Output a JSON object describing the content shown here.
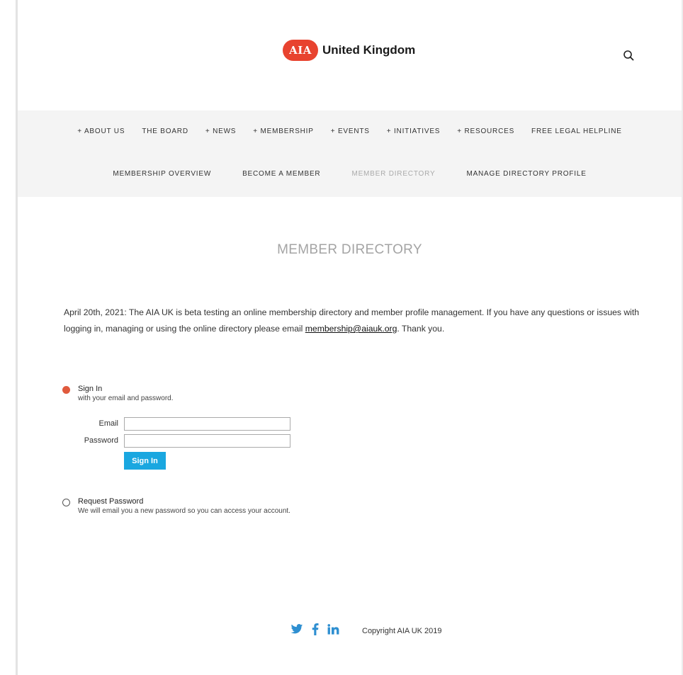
{
  "header": {
    "logo_badge": "AIA",
    "logo_text": "United Kingdom",
    "search_icon": "search-icon"
  },
  "nav": {
    "primary": [
      {
        "label": "+ ABOUT US"
      },
      {
        "label": "THE BOARD"
      },
      {
        "label": "+ NEWS"
      },
      {
        "label": "+ MEMBERSHIP"
      },
      {
        "label": "+ EVENTS"
      },
      {
        "label": "+ INITIATIVES"
      },
      {
        "label": "+ RESOURCES"
      },
      {
        "label": "FREE LEGAL HELPLINE"
      }
    ],
    "sub": [
      {
        "label": "MEMBERSHIP OVERVIEW",
        "active": false
      },
      {
        "label": "BECOME A MEMBER",
        "active": false
      },
      {
        "label": "MEMBER DIRECTORY",
        "active": true
      },
      {
        "label": "MANAGE DIRECTORY PROFILE",
        "active": false
      }
    ]
  },
  "page": {
    "title": "MEMBER DIRECTORY",
    "notice_before": "April 20th, 2021: The AIA UK is beta testing an online membership directory and member profile management. If you have any questions or issues with logging in, managing or using the online directory please email ",
    "notice_link": "membership@aiauk.org",
    "notice_after": ". Thank you."
  },
  "signin": {
    "title": "Sign In",
    "desc": "with your email and password.",
    "email_label": "Email",
    "email_value": "",
    "password_label": "Password",
    "password_value": "",
    "button": "Sign In"
  },
  "request_password": {
    "title": "Request Password",
    "desc": "We will email you a new password so you can access your account."
  },
  "footer": {
    "social_icons": [
      "twitter-icon",
      "facebook-icon",
      "linkedin-icon"
    ],
    "copyright": "Copyright AIA UK 2019"
  },
  "colors": {
    "brand_red": "#e8432f",
    "radio_active": "#e05a3d",
    "button_blue": "#1aa7e0",
    "social_blue": "#2e8fd1",
    "nav_band": "#f4f4f4"
  }
}
